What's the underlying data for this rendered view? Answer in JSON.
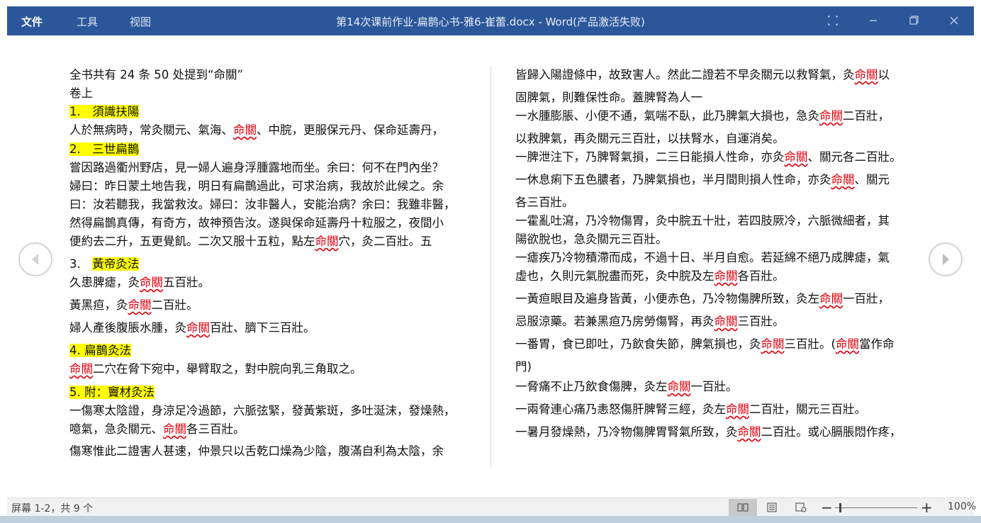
{
  "window": {
    "title": "第14次课前作业-扁鹊心书-雅6-崔蕾.docx - Word(产品激活失败)",
    "menu": [
      "文件",
      "工具",
      "视图"
    ]
  },
  "left_page": [
    [
      {
        "t": "全书共有 24 条 50 处提到“命關”"
      }
    ],
    [
      {
        "t": "卷上"
      }
    ],
    [
      {
        "t": "1.　須識扶陽",
        "hl": true
      }
    ],
    [
      {
        "t": "人於無病時，常灸關元、氣海、"
      },
      {
        "t": "命關",
        "mk": true
      },
      {
        "t": "、中脘，更服保元丹、保命延壽丹，"
      }
    ],
    [
      {
        "t": "2.　三世扁鵲",
        "hl": true
      }
    ],
    [
      {
        "t": "嘗因路過衢州野店，見一婦人遍身浮腫露地而坐。余曰：何不在門內坐？"
      }
    ],
    [
      {
        "t": "婦曰：昨日蒙土地告我，明日有扁鵲過此，可求治病，我故於此候之。余"
      }
    ],
    [
      {
        "t": "曰：汝若聽我，我當救汝。婦曰：汝非醫人，安能治病？余曰：我雖非醫，"
      }
    ],
    [
      {
        "t": "然得扁鵲真傳，有奇方，故神預告汝。遂與保命延壽丹十粒服之，夜間小"
      }
    ],
    [
      {
        "t": "便約去二升，五更覺飢。二次又服十五粒，點左"
      },
      {
        "t": "命關",
        "mk": true
      },
      {
        "t": "穴，灸二百壯。五"
      }
    ],
    [
      {
        "t": "3.　"
      },
      {
        "t": "黃帝灸法",
        "hl": true
      }
    ],
    [
      {
        "t": "久患脾瘧，灸"
      },
      {
        "t": "命關",
        "mk": true
      },
      {
        "t": "五百壯。"
      }
    ],
    [
      {
        "t": "黃黑疸，灸"
      },
      {
        "t": "命關",
        "mk": true
      },
      {
        "t": "二百壯。"
      }
    ],
    [
      {
        "t": "婦人產後腹脹水腫，灸"
      },
      {
        "t": "命關",
        "mk": true
      },
      {
        "t": "百壯、臍下三百壯。"
      }
    ],
    [
      {
        "t": "4. 扁鵲灸法",
        "hl": true
      }
    ],
    [
      {
        "t": "命關",
        "mk": true
      },
      {
        "t": "二穴在脅下宛中，舉臂取之，對中脘向乳三角取之。"
      }
    ],
    [
      {
        "t": "5. 附：竇材灸法",
        "hl": true
      }
    ],
    [
      {
        "t": "一傷寒太陰證，身涼足冷過節，六脈弦緊，發黃紫斑，多吐涎沫，發燥熱，"
      }
    ],
    [
      {
        "t": "噫氣，急灸關元、"
      },
      {
        "t": "命關",
        "mk": true
      },
      {
        "t": "各三百壯。"
      }
    ],
    [
      {
        "t": "傷寒惟此二證害人甚速，仲景只以舌乾口燥為少陰，腹滿自利為太陰，余"
      }
    ]
  ],
  "right_page": [
    [
      {
        "t": "皆歸入陽證條中，故致害人。然此二證若不早灸關元以救腎氣，灸"
      },
      {
        "t": "命關",
        "mk": true
      },
      {
        "t": "以"
      }
    ],
    [
      {
        "t": "固脾氣，則難保性命。蓋脾腎為人一"
      }
    ],
    [
      {
        "t": "一水腫膨脹、小便不通，氣喘不臥，此乃脾氣大損也，急灸"
      },
      {
        "t": "命關",
        "mk": true
      },
      {
        "t": "二百壯，"
      }
    ],
    [
      {
        "t": "以救脾氣，再灸關元三百壯，以扶腎水，自運消矣。"
      }
    ],
    [
      {
        "t": "一脾泄注下，乃脾腎氣損，二三日能損人性命，亦灸"
      },
      {
        "t": "命關",
        "mk": true
      },
      {
        "t": "、關元各二百壯。"
      }
    ],
    [
      {
        "t": "一休息痢下五色膿者，乃脾氣損也，半月間則損人性命，亦灸"
      },
      {
        "t": "命關",
        "mk": true
      },
      {
        "t": "、關元"
      }
    ],
    [
      {
        "t": "各三百壯。"
      }
    ],
    [
      {
        "t": "一霍亂吐瀉，乃冷物傷胃，灸中脘五十壯，若四肢厥冷，六脈微細者，其"
      }
    ],
    [
      {
        "t": "陽欲脫也，急灸關元三百壯。"
      }
    ],
    [
      {
        "t": "一瘧疾乃冷物積滯而成，不過十日、半月自愈。若延綿不絕乃成脾瘧，氣"
      }
    ],
    [
      {
        "t": "虛也，久則元氣脫盡而死，灸中脘及左"
      },
      {
        "t": "命關",
        "mk": true
      },
      {
        "t": "各百壯。"
      }
    ],
    [
      {
        "t": "一黃疸眼目及遍身皆黃，小便赤色，乃冷物傷脾所致，灸左"
      },
      {
        "t": "命關",
        "mk": true
      },
      {
        "t": "一百壯，"
      }
    ],
    [
      {
        "t": "忌服涼藥。若兼黑疸乃房勞傷腎，再灸"
      },
      {
        "t": "命關",
        "mk": true
      },
      {
        "t": "三百壯。"
      }
    ],
    [
      {
        "t": "一番胃，食已即吐，乃飲食失節，脾氣損也，灸"
      },
      {
        "t": "命關",
        "mk": true
      },
      {
        "t": "三百壯。("
      },
      {
        "t": "命關",
        "mk": true
      },
      {
        "t": "當作命"
      }
    ],
    [
      {
        "t": "門)"
      }
    ],
    [
      {
        "t": "一脅痛不止乃飲食傷脾，灸左"
      },
      {
        "t": "命關",
        "mk": true
      },
      {
        "t": "一百壯。"
      }
    ],
    [
      {
        "t": "一兩脅連心痛乃恚怒傷肝脾腎三經，灸左"
      },
      {
        "t": "命關",
        "mk": true
      },
      {
        "t": "二百壯，關元三百壯。"
      }
    ],
    [
      {
        "t": "一暑月發燥熱，乃冷物傷脾胃腎氣所致，灸"
      },
      {
        "t": "命關",
        "mk": true
      },
      {
        "t": "二百壯。或心膈脹悶作疼，"
      }
    ]
  ],
  "status": {
    "page_info": "屏幕 1-2，共 9 个",
    "zoom": "100%",
    "zoom_fraction": 0.05
  },
  "icons": {
    "prev": "chevron-left-icon",
    "next": "chevron-right-icon"
  },
  "colors": {
    "titlebar": "#2b579a",
    "highlight": "#ffff00",
    "mark": "#e0000c"
  }
}
